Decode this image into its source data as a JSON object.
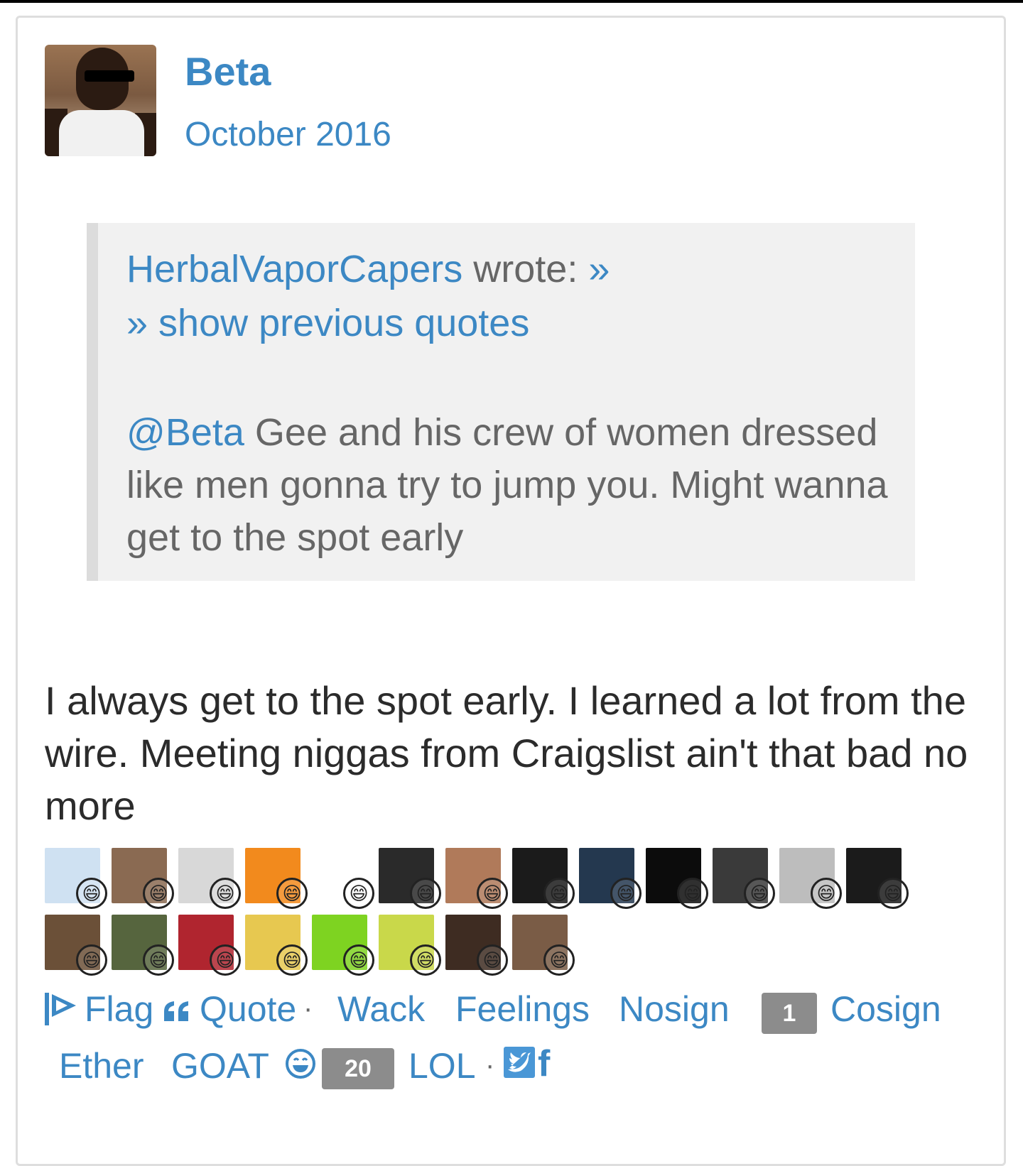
{
  "post": {
    "username": "Beta",
    "date": "October 2016",
    "avatar_icon": "user-avatar"
  },
  "quote": {
    "author": "HerbalVaporCapers",
    "wrote": "wrote:",
    "expand_arrow": "»",
    "show_previous": "» show previous quotes",
    "mention": "@Beta",
    "text": " Gee and his crew of women dressed like men gonna try to jump you. Might wanna get to the spot early"
  },
  "body": {
    "text": "I always get to the spot early. I learned a lot from the wire. Meeting niggas from Craigslist ain't that bad no more"
  },
  "reactions": {
    "badge_glyph": "😄",
    "reactors": [
      {
        "color": "#cfe1f2",
        "name": "reactor-1"
      },
      {
        "color": "#8a6a52",
        "name": "reactor-2"
      },
      {
        "color": "#d8d8d8",
        "name": "reactor-3"
      },
      {
        "color": "#f28a1d",
        "name": "reactor-4"
      },
      {
        "color": "#ffffff",
        "name": "reactor-5"
      },
      {
        "color": "#2a2a2a",
        "name": "reactor-6"
      },
      {
        "color": "#b07a5a",
        "name": "reactor-7"
      },
      {
        "color": "#1b1b1b",
        "name": "reactor-8"
      },
      {
        "color": "#24384f",
        "name": "reactor-9"
      },
      {
        "color": "#0c0c0c",
        "name": "reactor-10"
      },
      {
        "color": "#3a3a3a",
        "name": "reactor-11"
      },
      {
        "color": "#bdbdbd",
        "name": "reactor-12"
      },
      {
        "color": "#1b1b1b",
        "name": "reactor-13"
      },
      {
        "color": "#6b5038",
        "name": "reactor-14"
      },
      {
        "color": "#56653e",
        "name": "reactor-15"
      },
      {
        "color": "#b0252f",
        "name": "reactor-16"
      },
      {
        "color": "#e7c850",
        "name": "reactor-17"
      },
      {
        "color": "#7ed321",
        "name": "reactor-18"
      },
      {
        "color": "#c9d84a",
        "name": "reactor-19"
      },
      {
        "color": "#3e2c22",
        "name": "reactor-20"
      },
      {
        "color": "#7a5c46",
        "name": "reactor-21"
      }
    ]
  },
  "actions": {
    "flag": "Flag",
    "quote": "Quote",
    "dot": "·",
    "wack": "Wack",
    "feelings": "Feelings",
    "nosign": "Nosign",
    "cosign_count": "1",
    "cosign": "Cosign",
    "ether": "Ether",
    "goat": "GOAT",
    "lol_count": "20",
    "lol": "LOL",
    "facebook": "f"
  },
  "colors": {
    "link": "#3c88c4",
    "quote_bg": "#f1f1f1",
    "count_bg": "#8c8c8c"
  }
}
